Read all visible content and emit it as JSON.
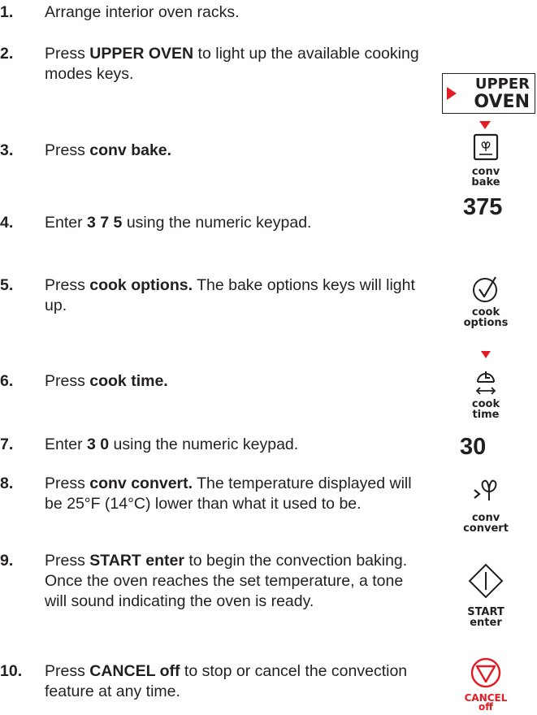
{
  "steps": [
    {
      "num": "1.",
      "parts": [
        {
          "t": "Arrange interior oven racks."
        }
      ]
    },
    {
      "num": "2.",
      "parts": [
        {
          "t": "Press "
        },
        {
          "t": "UPPER OVEN",
          "b": true
        },
        {
          "t": " to light up the available cooking modes keys."
        }
      ]
    },
    {
      "num": "3.",
      "parts": [
        {
          "t": "Press "
        },
        {
          "t": "conv bake.",
          "b": true
        }
      ]
    },
    {
      "num": "4.",
      "parts": [
        {
          "t": "Enter "
        },
        {
          "t": "3 7 5",
          "b": true
        },
        {
          "t": " using the numeric keypad."
        }
      ]
    },
    {
      "num": "5.",
      "parts": [
        {
          "t": "Press "
        },
        {
          "t": "cook options.",
          "b": true
        },
        {
          "t": " The bake options keys will light up."
        }
      ]
    },
    {
      "num": "6.",
      "parts": [
        {
          "t": "Press "
        },
        {
          "t": "cook time.",
          "b": true
        }
      ]
    },
    {
      "num": "7.",
      "parts": [
        {
          "t": "Enter "
        },
        {
          "t": "3 0",
          "b": true
        },
        {
          "t": " using the numeric keypad."
        }
      ]
    },
    {
      "num": "8.",
      "parts": [
        {
          "t": "Press "
        },
        {
          "t": "conv convert.",
          "b": true
        },
        {
          "t": " The temperature displayed will be 25°F (14°C) lower than what it used to be."
        }
      ]
    },
    {
      "num": "9.",
      "parts": [
        {
          "t": "Press "
        },
        {
          "t": "START enter",
          "b": true
        },
        {
          "t": " to begin the convection baking. Once the oven reaches the set temperature, a tone will sound indicating the oven is ready."
        }
      ]
    },
    {
      "num": "10.",
      "parts": [
        {
          "t": "Press "
        },
        {
          "t": "CANCEL off",
          "b": true
        },
        {
          "t": " to stop or cancel the convection feature at any time."
        }
      ]
    }
  ],
  "keys": {
    "upper_oven": {
      "line1": "UPPER",
      "line2": "OVEN"
    },
    "conv_bake": {
      "line1": "conv",
      "line2": "bake",
      "icon": "fan-icon"
    },
    "cook_options": {
      "line1": "cook",
      "line2": "options",
      "icon": "checkmark-circle-icon"
    },
    "cook_time": {
      "line1": "cook",
      "line2": "time",
      "icon": "clock-arrows-icon"
    },
    "conv_convert": {
      "line1": "conv",
      "line2": "convert",
      "icon": "convert-fan-icon"
    },
    "start_enter": {
      "line1": "START",
      "line2": "enter",
      "icon": "diamond-icon"
    },
    "cancel_off": {
      "line1": "CANCEL",
      "line2": "off",
      "icon": "triangle-circle-icon"
    }
  },
  "entries": {
    "temp": "375",
    "time": "30"
  },
  "colors": {
    "accent_red": "#e31b23",
    "text": "#231f20"
  }
}
